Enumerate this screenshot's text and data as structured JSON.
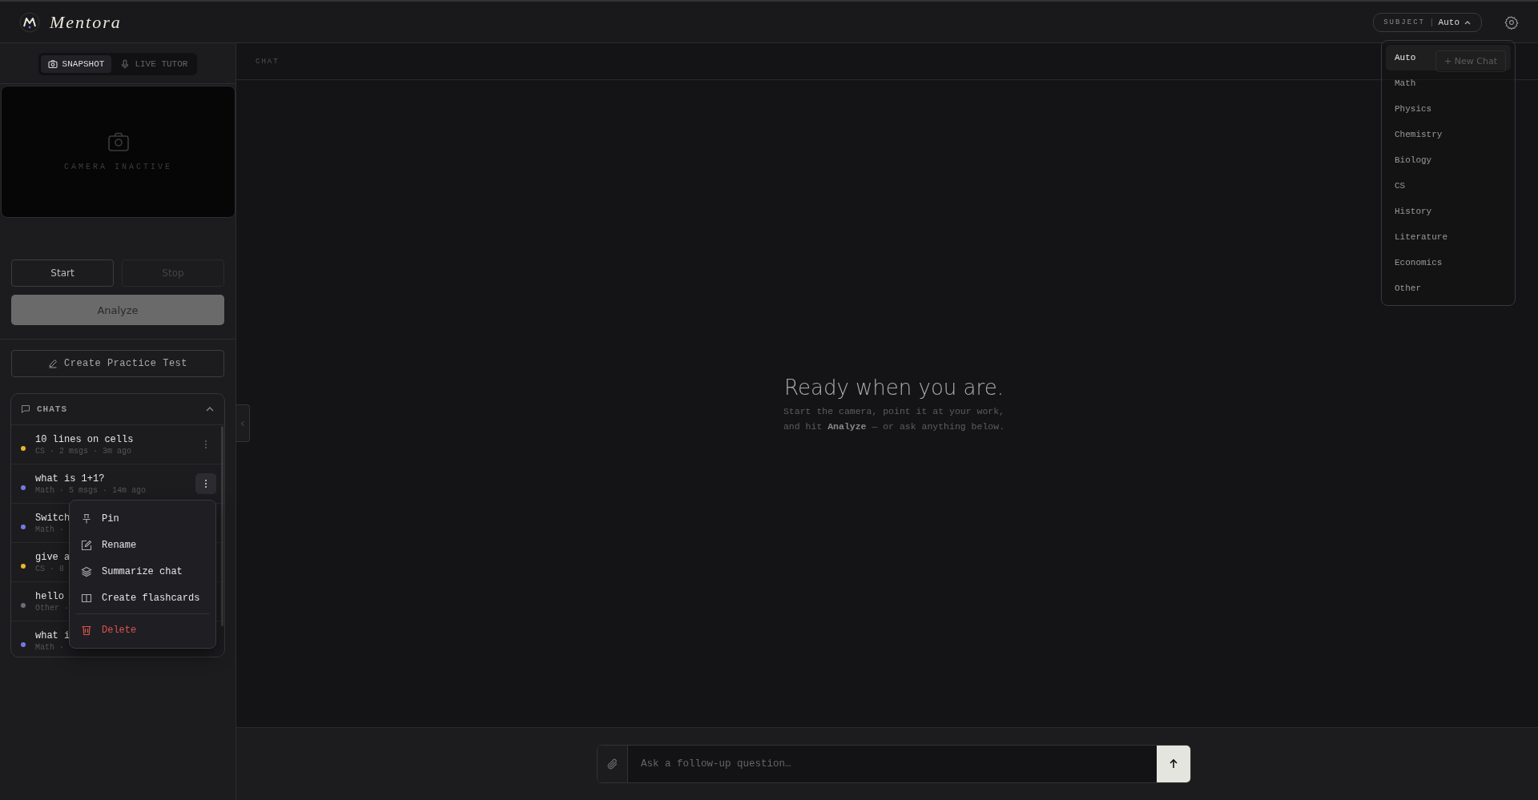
{
  "brand": {
    "name": "Mentora"
  },
  "subject": {
    "label": "SUBJECT",
    "separator": "|",
    "value": "Auto",
    "open": true
  },
  "mode_tabs": [
    {
      "label": "SNAPSHOT",
      "selected": true
    },
    {
      "label": "LIVE TUTOR",
      "selected": false
    }
  ],
  "camera": {
    "status": "CAMERA INACTIVE"
  },
  "controls": [
    {
      "label": "Start",
      "disabled": false
    },
    {
      "label": "Stop",
      "disabled": true
    }
  ],
  "analyze": {
    "label": "Analyze"
  },
  "practice": {
    "label": "Create Practice Test"
  },
  "chats": {
    "title": "CHATS",
    "expanded": true,
    "items": [
      {
        "title": "10 lines on cells",
        "meta": "CS · 2 msgs · 3m ago",
        "color": "#e8b52c",
        "menu_open": false
      },
      {
        "title": "what is 1+1?",
        "meta": "Math · 5 msgs · 14m ago",
        "color": "#7479e6",
        "menu_open": true
      },
      {
        "title": "Switch",
        "meta": "Math ·",
        "color": "#7479e6"
      },
      {
        "title": "give a",
        "meta": "CS · 8",
        "color": "#e8b52c"
      },
      {
        "title": "hello",
        "meta": "Other ·",
        "color": "#6b6e78"
      },
      {
        "title": "what i",
        "meta": "Math ·",
        "color": "#7479e6"
      }
    ]
  },
  "context_menu": [
    {
      "label": "Pin",
      "kind": "normal"
    },
    {
      "label": "Rename",
      "kind": "normal"
    },
    {
      "label": "Summarize chat",
      "kind": "normal"
    },
    {
      "label": "Create flashcards",
      "kind": "normal"
    },
    {
      "label": "Delete",
      "kind": "danger"
    }
  ],
  "chat_header": {
    "title": "CHAT",
    "new_chat": "+ New Chat"
  },
  "empty_state": {
    "heading": "Ready when you are.",
    "lines": [
      "Start the camera, point it at your work,",
      "and hit **Analyze** — or ask anything below."
    ]
  },
  "composer": {
    "placeholder": "Ask a follow-up question…"
  },
  "subject_options": [
    {
      "label": "Auto",
      "selected": true
    },
    {
      "label": "Math",
      "selected": false
    },
    {
      "label": "Physics",
      "selected": false
    },
    {
      "label": "Chemistry",
      "selected": false
    },
    {
      "label": "Biology",
      "selected": false
    },
    {
      "label": "CS",
      "selected": false
    },
    {
      "label": "History",
      "selected": false
    },
    {
      "label": "Literature",
      "selected": false
    },
    {
      "label": "Economics",
      "selected": false
    },
    {
      "label": "Other",
      "selected": false
    }
  ]
}
